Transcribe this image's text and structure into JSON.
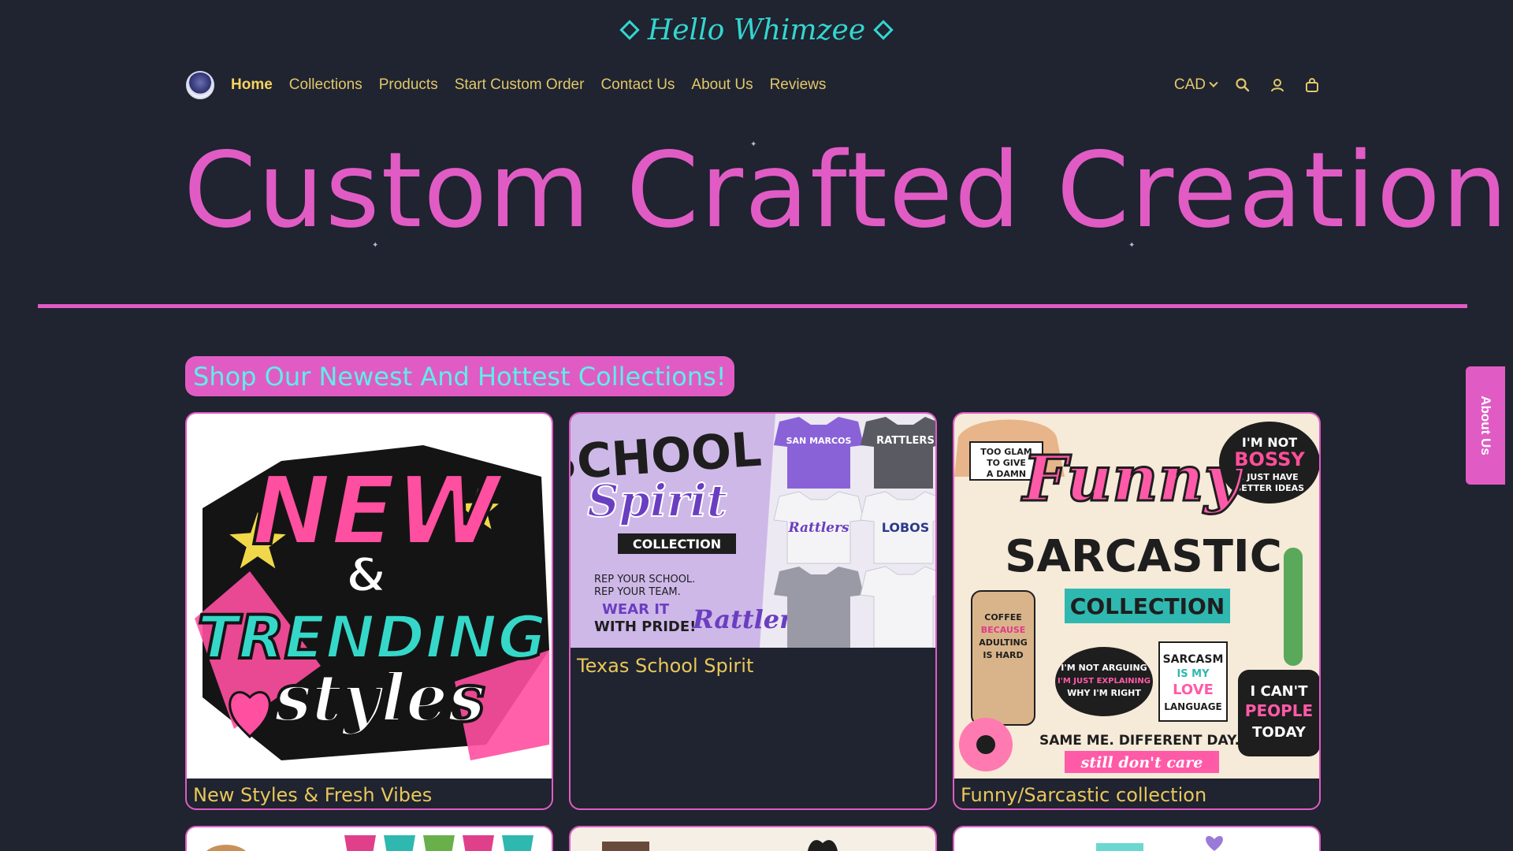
{
  "announcement": {
    "text": "Hello Whimzee"
  },
  "header": {
    "nav": [
      "Home",
      "Collections",
      "Products",
      "Start Custom Order",
      "Contact Us",
      "About Us",
      "Reviews"
    ],
    "active_index": 0,
    "currency": "CAD",
    "icons": [
      "search-icon",
      "account-icon",
      "cart-icon"
    ]
  },
  "hero": {
    "title": "Custom Crafted Creations"
  },
  "collections": {
    "heading": "Shop Our Newest And Hottest Collections!",
    "cards": [
      {
        "caption": "New Styles & Fresh Vibes",
        "art": {
          "line1": "NEW",
          "line2": "&",
          "line3": "TRENDING",
          "line4": "styles"
        }
      },
      {
        "caption": "Texas School Spirit",
        "art": {
          "line1": "SCHOOL",
          "line2": "Spirit",
          "line3": "COLLECTION",
          "tag1": "REP YOUR SCHOOL.",
          "tag2": "REP YOUR TEAM.",
          "tag3": "WEAR IT",
          "tag4": "WITH PRIDE!",
          "shirt1": "SAN MARCOS",
          "shirt2": "RATTLERS",
          "shirt3": "Rattlers",
          "shirt4": "LOBOS",
          "script": "Rattlers"
        }
      },
      {
        "caption": "Funny/Sarcastic collection",
        "art": {
          "line1": "Funny",
          "line2": "SARCASTIC",
          "line3": "COLLECTION",
          "bubble1": "I'M NOT",
          "bubble2": "BOSSY",
          "bubble3": "I JUST HAVE",
          "bubble4": "BETTER IDEAS",
          "hat1": "TOO GLAM",
          "hat2": "TO GIVE",
          "hat3": "A DAMN",
          "cup1": "COFFEE",
          "cup2": "BECAUSE",
          "cup3": "ADULTING",
          "cup4": "IS HARD",
          "mid1": "I'M NOT ARGUING",
          "mid2": "I'M JUST EXPLAINING",
          "mid3": "WHY I'M RIGHT",
          "sign1": "SARCASM",
          "sign2": "IS MY",
          "sign3": "LOVE",
          "sign4": "LANGUAGE",
          "right1": "I CAN'T",
          "right2": "PEOPLE",
          "right3": "TODAY",
          "bottom1": "SAME ME. DIFFERENT DAY.",
          "bottom2": "still don't care"
        }
      }
    ]
  },
  "side_tab": {
    "label": "About Us"
  },
  "colors": {
    "background": "#202330",
    "accent": "#e05cc4",
    "teal": "#33d6d0",
    "gold": "#e8c85a"
  }
}
